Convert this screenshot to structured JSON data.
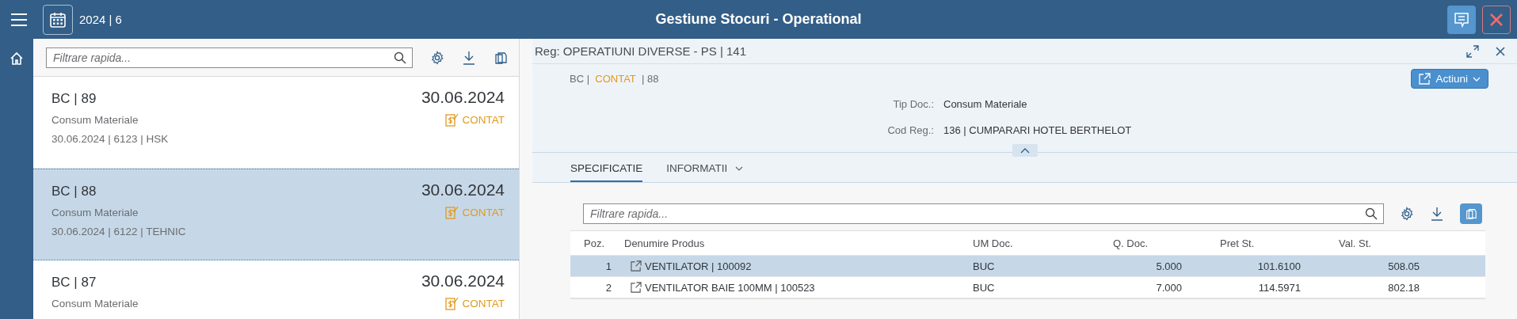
{
  "header": {
    "period": "2024 | 6",
    "title": "Gestiune Stocuri - Operational"
  },
  "list": {
    "filter": {
      "placeholder": "Filtrare rapida..."
    },
    "items": [
      {
        "title": "BC | 89",
        "date": "30.06.2024",
        "type": "Consum Materiale",
        "status": "CONTAT",
        "info": "30.06.2024 | 6123 | HSK",
        "selected": false
      },
      {
        "title": "BC | 88",
        "date": "30.06.2024",
        "type": "Consum Materiale",
        "status": "CONTAT",
        "info": "30.06.2024 | 6122 | TEHNIC",
        "selected": true
      },
      {
        "title": "BC | 87",
        "date": "30.06.2024",
        "type": "Consum Materiale",
        "status": "CONTAT",
        "selected": false
      }
    ]
  },
  "detail": {
    "title": "Reg: OPERATIUNI DIVERSE - PS | 141",
    "doc": {
      "prefix": "BC |",
      "status": "CONTAT",
      "number": "| 88"
    },
    "actions_button": "Actiuni",
    "fields": [
      {
        "label": "Tip Doc.:",
        "value": "Consum Materiale"
      },
      {
        "label": "Cod Reg.:",
        "value": "136 | CUMPARARI HOTEL BERTHELOT"
      }
    ],
    "tabs": [
      {
        "label": "SPECIFICATIE",
        "selected": true,
        "has_menu": false
      },
      {
        "label": "INFORMATII",
        "selected": false,
        "has_menu": true
      }
    ],
    "table": {
      "filter": {
        "placeholder": "Filtrare rapida..."
      },
      "grouping_on": true,
      "columns": [
        "Poz.",
        "Denumire Produs",
        "UM Doc.",
        "Q. Doc.",
        "Pret St.",
        "Val. St."
      ],
      "rows": [
        {
          "selected": true,
          "cells": [
            "1",
            "VENTILATOR | 100092",
            "BUC",
            "5.000",
            "101.6100",
            "508.05"
          ]
        },
        {
          "selected": false,
          "cells": [
            "2",
            "VENTILATOR BAIE 100MM | 100523",
            "BUC",
            "7.000",
            "114.5971",
            "802.18"
          ]
        }
      ]
    }
  }
}
